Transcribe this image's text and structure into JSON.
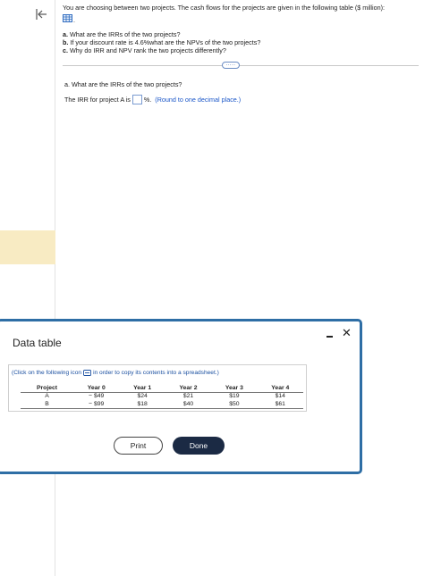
{
  "question": {
    "intro": "You are choosing between two projects. The cash flows for the projects are given in the following table ($ million):",
    "icon_suffix": ".",
    "part_a_label": "a.",
    "part_a": "What are the IRRs of the two projects?",
    "part_b_label": "b.",
    "part_b": "If your discount rate is 4.6%what are the NPVs of the two projects?",
    "part_c_label": "c.",
    "part_c": "Why do IRR and NPV rank the two projects differently?",
    "more_label": "....."
  },
  "answer": {
    "heading": "a. What are the IRRs of the two projects?",
    "irr_prefix": "The IRR for project A is",
    "irr_value": "",
    "irr_suffix": "%.",
    "hint": "(Round to one decimal place.)"
  },
  "modal": {
    "title": "Data table",
    "minimize_icon": "minimize-icon",
    "close_label": "✕",
    "caption_before": "(Click on the following icon",
    "caption_after": "in order to copy its contents into a spreadsheet.)",
    "columns": [
      "Project",
      "Year 0",
      "Year 1",
      "Year 2",
      "Year 3",
      "Year 4"
    ],
    "rows": [
      [
        "A",
        "− $49",
        "$24",
        "$21",
        "$19",
        "$14"
      ],
      [
        "B",
        "− $99",
        "$18",
        "$40",
        "$50",
        "$61"
      ]
    ],
    "print_label": "Print",
    "done_label": "Done"
  },
  "colors": {
    "accent_border": "#2e6ea5",
    "done_button": "#1b2a44",
    "hint_text": "#1a56c8",
    "rail_highlight": "#f8ebc3"
  }
}
